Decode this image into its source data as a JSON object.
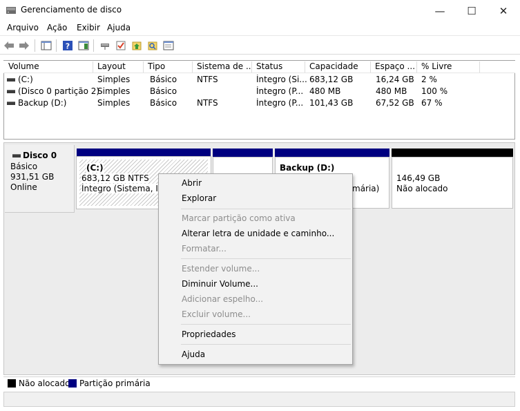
{
  "window": {
    "title": "Gerenciamento de disco",
    "minimize": "—",
    "maximize": "☐",
    "close": "✕"
  },
  "menu": [
    "Arquivo",
    "Ação",
    "Exibir",
    "Ajuda"
  ],
  "toolbar_icons": [
    "back-arrow-icon",
    "forward-arrow-icon",
    "console-tree-icon",
    "help-icon",
    "action-pane-icon",
    "connect-icon",
    "check-icon",
    "up-icon",
    "search-icon",
    "properties-icon"
  ],
  "volume_list": {
    "columns": [
      "Volume",
      "Layout",
      "Tipo",
      "Sistema de ...",
      "Status",
      "Capacidade",
      "Espaço ...",
      "% Livre"
    ],
    "rows": [
      [
        "(C:)",
        "Simples",
        "Básico",
        "NTFS",
        "Íntegro (Si...",
        "683,12 GB",
        "16,24 GB",
        "2 %"
      ],
      [
        "(Disco 0 partição 2)",
        "Simples",
        "Básico",
        "",
        "Íntegro (P...",
        "480 MB",
        "480 MB",
        "100 %"
      ],
      [
        "Backup (D:)",
        "Simples",
        "Básico",
        "NTFS",
        "Íntegro (P...",
        "101,43 GB",
        "67,52 GB",
        "67 %"
      ]
    ]
  },
  "disk": {
    "name": "Disco 0",
    "type": "Básico",
    "size": "931,51 GB",
    "state": "Online"
  },
  "partitions": {
    "c": {
      "name": "(C:)",
      "line1": "683,12 GB NTFS",
      "line2": "Íntegro (Sistema, Inic"
    },
    "backup": {
      "name": "Backup  (D:)",
      "line2": "mária)"
    },
    "unalloc": {
      "size": "146,49 GB",
      "label": "Não alocado"
    }
  },
  "legend": {
    "unallocated": "Não alocado",
    "primary": "Partição primária"
  },
  "colors": {
    "primary": "#000080",
    "unallocated": "#000000"
  },
  "context_menu": [
    {
      "label": "Abrir",
      "enabled": true
    },
    {
      "label": "Explorar",
      "enabled": true
    },
    {
      "label": "Marcar partição como ativa",
      "enabled": false
    },
    {
      "label": "Alterar letra de unidade e caminho...",
      "enabled": true
    },
    {
      "label": "Formatar...",
      "enabled": false
    },
    {
      "label": "Estender volume...",
      "enabled": false
    },
    {
      "label": "Diminuir Volume...",
      "enabled": true
    },
    {
      "label": "Adicionar espelho...",
      "enabled": false
    },
    {
      "label": "Excluir volume...",
      "enabled": false
    },
    {
      "label": "Propriedades",
      "enabled": true
    },
    {
      "label": "Ajuda",
      "enabled": true
    }
  ]
}
